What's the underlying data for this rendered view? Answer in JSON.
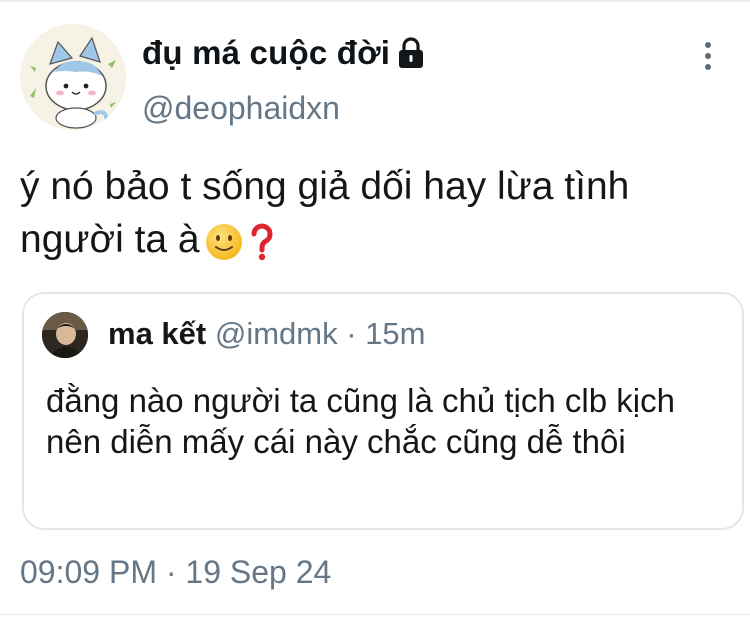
{
  "tweet": {
    "author": {
      "display_name": "đụ má cuộc đời",
      "handle": "@deophaidxn",
      "avatar_icon": "cat-avatar",
      "lock_icon": "lock-icon"
    },
    "more_icon": "more-vertical-icon",
    "text": "ý nó bảo t sống giả dối hay lừa tình người ta à",
    "emojis": [
      "slightly-smiling-face",
      "red-question-mark"
    ],
    "quoted_tweet": {
      "display_name": "ma kết",
      "handle": "@imdmk",
      "separator": "·",
      "time_ago": "15m",
      "text": "đằng nào người ta cũng là chủ tịch clb kịch nên diễn mấy cái này chắc cũng dễ thôi"
    },
    "timestamp": "09:09 PM · 19 Sep 24"
  },
  "colors": {
    "primary_text": "#14171a",
    "secondary_text": "#657786",
    "border": "#e1e8ed"
  }
}
